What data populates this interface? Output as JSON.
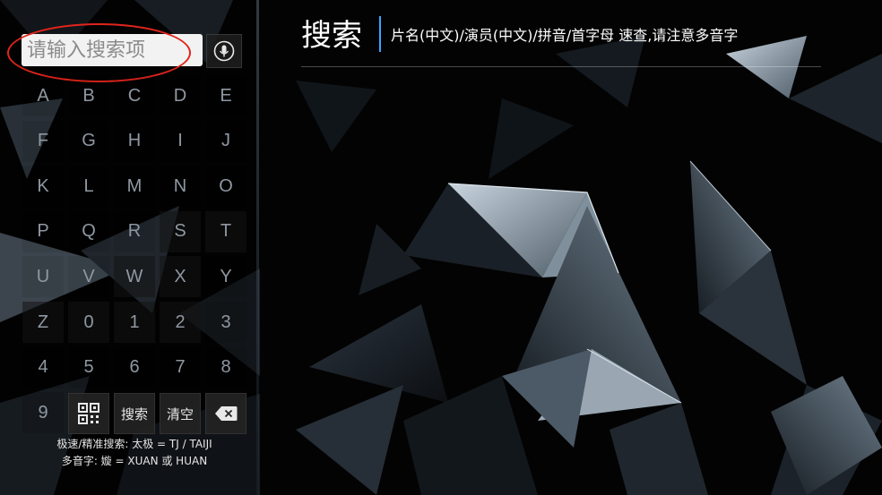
{
  "search": {
    "placeholder": "请输入搜索项",
    "value": ""
  },
  "mic": {
    "icon": "microphone-icon"
  },
  "header": {
    "title": "搜索",
    "subtitle": "片名(中文)/演员(中文)/拼音/首字母 速查,请注意多音字"
  },
  "keyboard": {
    "keys": [
      "A",
      "B",
      "C",
      "D",
      "E",
      "F",
      "G",
      "H",
      "I",
      "J",
      "K",
      "L",
      "M",
      "N",
      "O",
      "P",
      "Q",
      "R",
      "S",
      "T",
      "U",
      "V",
      "W",
      "X",
      "Y",
      "Z",
      "0",
      "1",
      "2",
      "3",
      "4",
      "5",
      "6",
      "7",
      "8",
      "9"
    ],
    "qr_icon": "qr-code-icon",
    "search_label": "搜索",
    "clear_label": "清空",
    "backspace_icon": "backspace-icon"
  },
  "hints": {
    "line1": "极速/精准搜索: 太极 = TJ / TAIJI",
    "line2": "多音字: 嫙 = XUAN 或 HUAN"
  },
  "colors": {
    "highlight": "#e0241c",
    "accent": "#3da4ff"
  }
}
